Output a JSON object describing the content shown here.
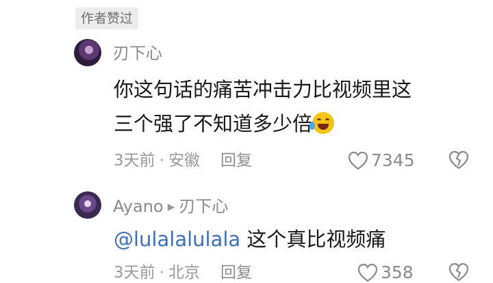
{
  "badge": "作者赞过",
  "comment": {
    "author": "刃下心",
    "text_line1": "你这句话的痛苦冲击力比视频里这",
    "text_line2": "三个强了不知道多少倍",
    "time": "3天前",
    "location": "安徽",
    "reply_label": "回复",
    "likes": "7345"
  },
  "reply": {
    "author": "Ayano",
    "reply_to": "刃下心",
    "mention": "@lulalalulala",
    "text": "这个真比视频痛",
    "time": "3天前",
    "location": "北京",
    "reply_label": "回复",
    "likes": "358"
  },
  "icons": [
    "heart-outline-icon",
    "broken-heart-icon",
    "laughing-tears-emoji"
  ]
}
